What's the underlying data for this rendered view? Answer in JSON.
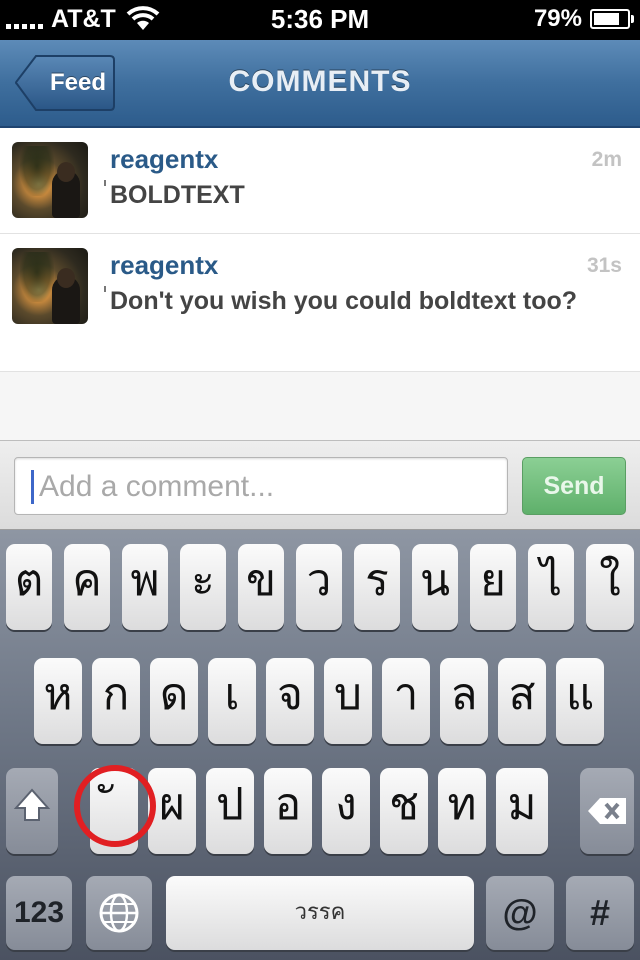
{
  "status_bar": {
    "carrier": "AT&T",
    "time": "5:36 PM",
    "battery": "79%",
    "battery_level": 0.79,
    "icons": [
      "signal-icon",
      "wifi-icon",
      "battery-icon"
    ]
  },
  "nav": {
    "back_label": "Feed",
    "title": "COMMENTS"
  },
  "comments": [
    {
      "username": "reagentx",
      "time": "2m",
      "text": "BOLDTEXT"
    },
    {
      "username": "reagentx",
      "time": "31s",
      "text": "Don't you wish you could boldtext too?"
    }
  ],
  "comment_input": {
    "placeholder": "Add a comment...",
    "value": "",
    "send_label": "Send"
  },
  "keyboard": {
    "row1": [
      "ต",
      "ค",
      "พ",
      "ะ",
      "ข",
      "ว",
      "ร",
      "น",
      "ย",
      "ไ",
      "ใ"
    ],
    "row2": [
      "ห",
      "ก",
      "ด",
      "เ",
      "จ",
      "บ",
      "า",
      "ล",
      "ส",
      "แ"
    ],
    "row3": [
      "ั",
      "ผ",
      "ป",
      "อ",
      "ง",
      "ช",
      "ท",
      "ม"
    ],
    "numbers_label": "123",
    "space_label": "วรรค",
    "at_label": "@",
    "hash_label": "#",
    "icons": [
      "shift-icon",
      "globe-icon",
      "backspace-icon"
    ]
  },
  "colors": {
    "nav_blue": "#3f6f9e",
    "username_blue": "#2a5a88",
    "send_green": "#6dbb76",
    "highlight_red": "#e11f22",
    "caret_blue": "#3d67c9"
  }
}
